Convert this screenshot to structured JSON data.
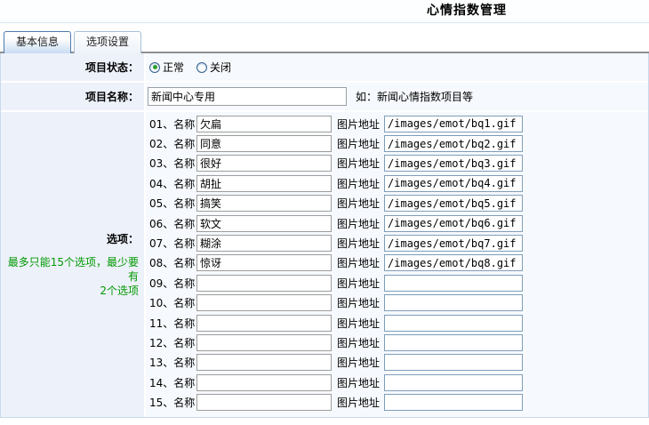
{
  "title": "心情指数管理",
  "tabs": [
    {
      "label": "基本信息",
      "active": true
    },
    {
      "label": "选项设置",
      "active": false
    }
  ],
  "form": {
    "status_label": "项目状态：",
    "status_options": [
      {
        "label": "正常",
        "checked": true
      },
      {
        "label": "关闭",
        "checked": false
      }
    ],
    "name_label": "项目名称：",
    "name_value": "新闻中心专用",
    "name_hint": "如：新闻心情指数项目等",
    "options_label": "选项：",
    "options_hint_line1": "最多只能15个选项，最少要有",
    "options_hint_line2": "2个选项",
    "option_image_label": "图片地址",
    "options": [
      {
        "label": "01、名称",
        "name": "欠扁",
        "image": "/images/emot/bq1.gif"
      },
      {
        "label": "02、名称",
        "name": "同意",
        "image": "/images/emot/bq2.gif"
      },
      {
        "label": "03、名称",
        "name": "很好",
        "image": "/images/emot/bq3.gif"
      },
      {
        "label": "04、名称",
        "name": "胡扯",
        "image": "/images/emot/bq4.gif"
      },
      {
        "label": "05、名称",
        "name": "搞笑",
        "image": "/images/emot/bq5.gif"
      },
      {
        "label": "06、名称",
        "name": "软文",
        "image": "/images/emot/bq6.gif"
      },
      {
        "label": "07、名称",
        "name": "糊涂",
        "image": "/images/emot/bq7.gif"
      },
      {
        "label": "08、名称",
        "name": "惊讶",
        "image": "/images/emot/bq8.gif"
      },
      {
        "label": "09、名称",
        "name": "",
        "image": ""
      },
      {
        "label": "10、名称",
        "name": "",
        "image": ""
      },
      {
        "label": "11、名称",
        "name": "",
        "image": ""
      },
      {
        "label": "12、名称",
        "name": "",
        "image": ""
      },
      {
        "label": "13、名称",
        "name": "",
        "image": ""
      },
      {
        "label": "14、名称",
        "name": "",
        "image": ""
      },
      {
        "label": "15、名称",
        "name": "",
        "image": ""
      }
    ]
  },
  "colors": {
    "hint_green": "#009900",
    "active_tab_border": "#4f7bb0",
    "label_cell_bg": "#edf1fa",
    "image_input_border": "#7f9db9"
  }
}
